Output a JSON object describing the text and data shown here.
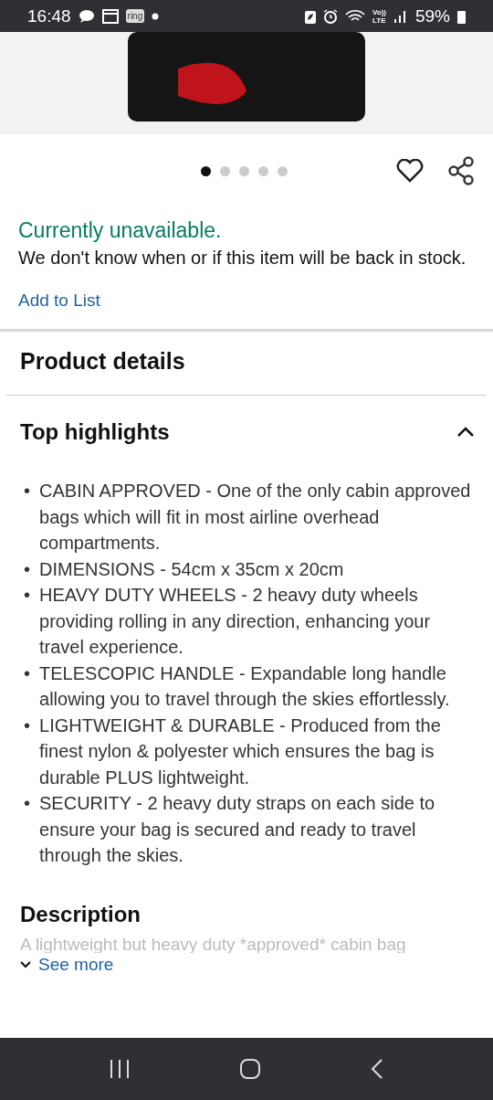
{
  "status_bar": {
    "time": "16:48",
    "notification_badge": "ring",
    "network_top": "Vo))",
    "network_bottom": "LTE",
    "battery": "59%"
  },
  "gallery": {
    "dots": [
      {
        "selected": true
      },
      {
        "selected": false
      },
      {
        "selected": false
      },
      {
        "selected": false
      },
      {
        "selected": false
      }
    ]
  },
  "availability": {
    "status": "Currently unavailable.",
    "message": "We don't know when or if this item will be back in stock.",
    "link": "Add to List"
  },
  "product_details": {
    "title": "Product details"
  },
  "highlights": {
    "title": "Top highlights",
    "expanded": true,
    "items": [
      {
        "bullet": "•",
        "text": "CABIN APPROVED - One of the only cabin approved bags which will fit in most airline overhead compartments."
      },
      {
        "bullet": "•",
        "text": "DIMENSIONS - 54cm x 35cm x 20cm"
      },
      {
        "bullet": "•",
        "text": "HEAVY DUTY WHEELS - 2 heavy duty wheels providing rolling in any direction, enhancing your travel experience."
      },
      {
        "bullet": "•",
        "text": "TELESCOPIC HANDLE - Expandable long handle allowing you to travel through the skies effortlessly."
      },
      {
        "bullet": "•",
        "text": "LIGHTWEIGHT & DURABLE - Produced from the finest nylon & polyester which ensures the bag is durable PLUS lightweight."
      },
      {
        "bullet": "•",
        "text": "SECURITY - 2 heavy duty straps on each side to ensure your bag is secured and ready to travel through the skies."
      }
    ]
  },
  "description": {
    "title": "Description",
    "preview": "A lightweight but heavy duty *approved* cabin bag",
    "see_more": "See more"
  }
}
